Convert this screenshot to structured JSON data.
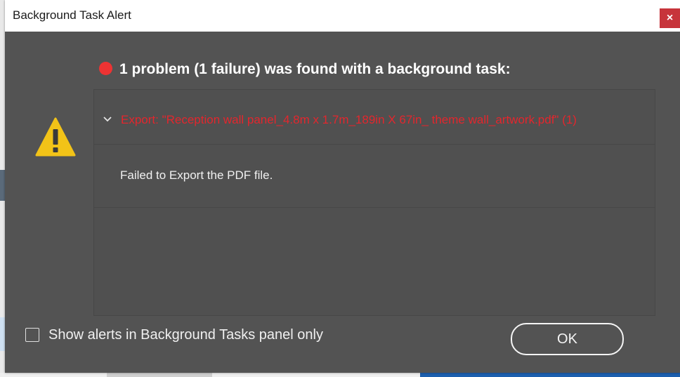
{
  "window": {
    "title": "Background Task Alert",
    "close_label": "×"
  },
  "alert": {
    "headline": "1 problem (1 failure) was found with a background task:",
    "status_color": "#ee3333",
    "warning_icon": "warning-triangle-icon"
  },
  "problems": [
    {
      "label": "Export: \"Reception wall panel_4.8m x 1.7m_189in X 67in_ theme wall_artwork.pdf\" (1)",
      "expanded": true,
      "detail": "Failed to Export the PDF file."
    }
  ],
  "footer": {
    "checkbox_label": "Show alerts in Background Tasks panel only",
    "checkbox_checked": false,
    "ok_label": "OK"
  },
  "colors": {
    "dialog_bg": "#535353",
    "error_text": "#e3262d",
    "close_button": "#c7343b"
  }
}
